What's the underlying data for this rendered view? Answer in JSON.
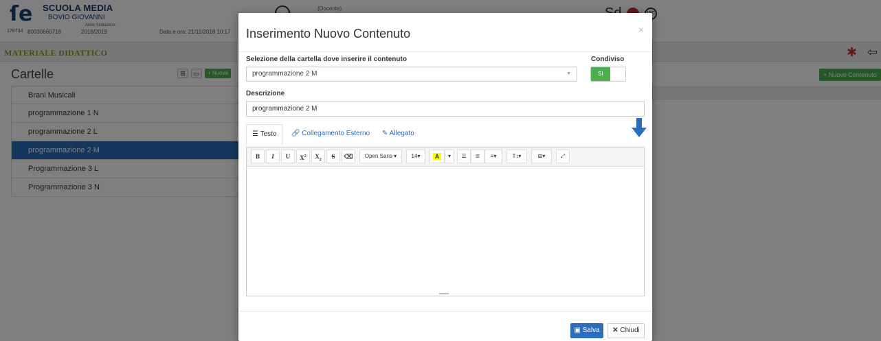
{
  "header": {
    "school_name": "SCUOLA MEDIA",
    "school_sub": "BOVIO GIOVANNI",
    "code_small": "178734",
    "code": "80030660718",
    "anno_label": "Anno Scolastico:",
    "anno_value": "2018/2019",
    "dataora": "Data e ora: 21/11/2018 10:17",
    "docente": "(Docente)",
    "sd_label": "Sd",
    "isc_label": "ISC"
  },
  "section": {
    "title": "MATERIALE DIDATTICO"
  },
  "cartelle": {
    "title": "Cartelle",
    "nuova_label": "+ Nuova",
    "nuovo_contenuto_label": "+ Nuovo Contenuto",
    "items": [
      {
        "label": "Brani Musicali"
      },
      {
        "label": "programmazione 1 N"
      },
      {
        "label": "programmazione 2 L"
      },
      {
        "label": "programmazione 2 M"
      },
      {
        "label": "Programmazione 3 L"
      },
      {
        "label": "Programmazione 3 N"
      }
    ],
    "active_index": 3
  },
  "modal": {
    "title": "Inserimento Nuovo Contenuto",
    "close_label": "×",
    "folder_label": "Selezione della cartella dove inserire il contenuto",
    "folder_value": "programmazione 2 M",
    "shared_label": "Condiviso",
    "shared_value": "SI",
    "description_label": "Descrizione",
    "description_value": "programmazione 2 M",
    "tabs": [
      {
        "label": "Testo"
      },
      {
        "label": "Collegamento Esterno"
      },
      {
        "label": "Allegato"
      }
    ],
    "toolbar": {
      "font": "Open Sans",
      "size": "14"
    },
    "save_label": "Salva",
    "close_button_label": "Chiudi"
  },
  "colors": {
    "primary": "#2a6ebb",
    "success": "#4cae4c",
    "section_title": "#8a9a1a"
  }
}
